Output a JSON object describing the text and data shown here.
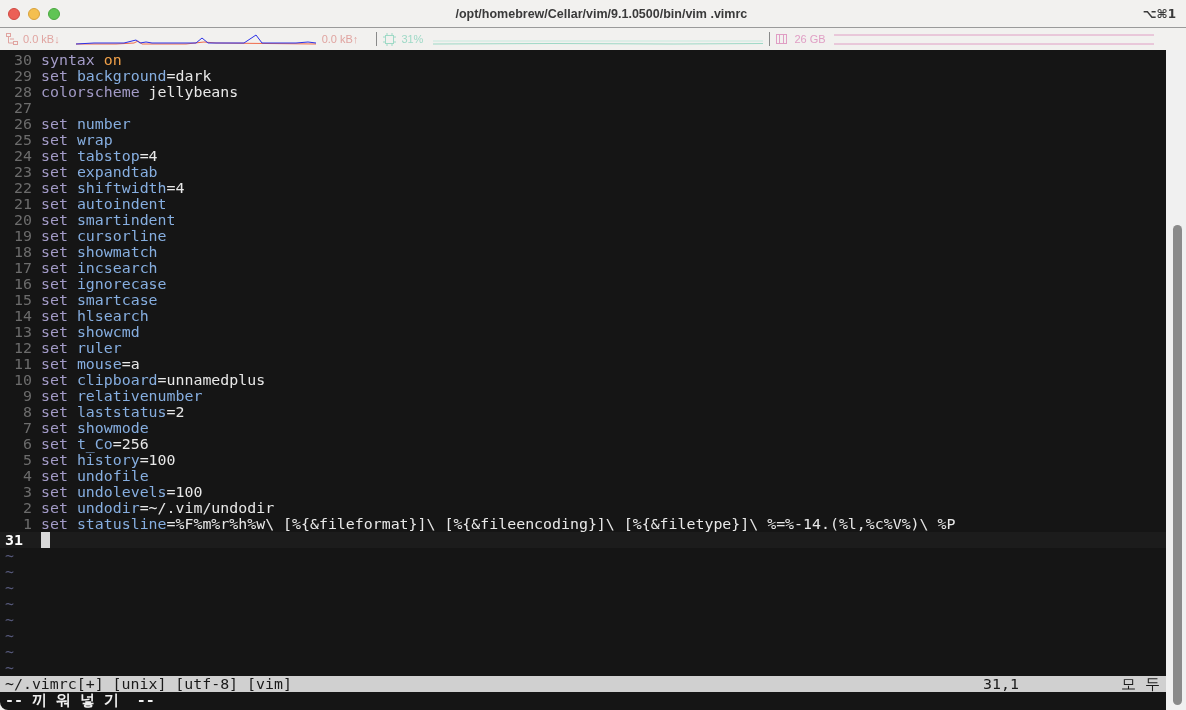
{
  "window": {
    "title": "/opt/homebrew/Cellar/vim/9.1.0500/bin/vim .vimrc",
    "shortcut": "⌥⌘1"
  },
  "stats_bar": {
    "network": {
      "down": "0.0 kB↓",
      "up": "0.0 kB↑"
    },
    "cpu": {
      "reading": "31%"
    },
    "memory": {
      "reading": "26 GB"
    }
  },
  "editor": {
    "lines": [
      {
        "n": "30",
        "cmd": "syntax",
        "arg": "on",
        "kind": "constant"
      },
      {
        "n": "29",
        "cmd": "set",
        "arg": "background",
        "val": "=dark",
        "kind": "option"
      },
      {
        "n": "28",
        "cmd": "colorscheme",
        "arg": "jellybeans",
        "kind": "plain"
      },
      {
        "n": "27"
      },
      {
        "n": "26",
        "cmd": "set",
        "arg": "number",
        "kind": "option"
      },
      {
        "n": "25",
        "cmd": "set",
        "arg": "wrap",
        "kind": "option"
      },
      {
        "n": "24",
        "cmd": "set",
        "arg": "tabstop",
        "val": "=4",
        "kind": "option"
      },
      {
        "n": "23",
        "cmd": "set",
        "arg": "expandtab",
        "kind": "option"
      },
      {
        "n": "22",
        "cmd": "set",
        "arg": "shiftwidth",
        "val": "=4",
        "kind": "option"
      },
      {
        "n": "21",
        "cmd": "set",
        "arg": "autoindent",
        "kind": "option"
      },
      {
        "n": "20",
        "cmd": "set",
        "arg": "smartindent",
        "kind": "option"
      },
      {
        "n": "19",
        "cmd": "set",
        "arg": "cursorline",
        "kind": "option"
      },
      {
        "n": "18",
        "cmd": "set",
        "arg": "showmatch",
        "kind": "option"
      },
      {
        "n": "17",
        "cmd": "set",
        "arg": "incsearch",
        "kind": "option"
      },
      {
        "n": "16",
        "cmd": "set",
        "arg": "ignorecase",
        "kind": "option"
      },
      {
        "n": "15",
        "cmd": "set",
        "arg": "smartcase",
        "kind": "option"
      },
      {
        "n": "14",
        "cmd": "set",
        "arg": "hlsearch",
        "kind": "option"
      },
      {
        "n": "13",
        "cmd": "set",
        "arg": "showcmd",
        "kind": "option"
      },
      {
        "n": "12",
        "cmd": "set",
        "arg": "ruler",
        "kind": "option"
      },
      {
        "n": "11",
        "cmd": "set",
        "arg": "mouse",
        "val": "=a",
        "kind": "option"
      },
      {
        "n": "10",
        "cmd": "set",
        "arg": "clipboard",
        "val": "=unnamedplus",
        "kind": "option"
      },
      {
        "n": "9",
        "cmd": "set",
        "arg": "relativenumber",
        "kind": "option"
      },
      {
        "n": "8",
        "cmd": "set",
        "arg": "laststatus",
        "val": "=2",
        "kind": "option"
      },
      {
        "n": "7",
        "cmd": "set",
        "arg": "showmode",
        "kind": "option"
      },
      {
        "n": "6",
        "cmd": "set",
        "arg": "t_Co",
        "val": "=256",
        "kind": "option"
      },
      {
        "n": "5",
        "cmd": "set",
        "arg": "history",
        "val": "=100",
        "kind": "option"
      },
      {
        "n": "4",
        "cmd": "set",
        "arg": "undofile",
        "kind": "option"
      },
      {
        "n": "3",
        "cmd": "set",
        "arg": "undolevels",
        "val": "=100",
        "kind": "option"
      },
      {
        "n": "2",
        "cmd": "set",
        "arg": "undodir",
        "val": "=~/.vim/undodir",
        "kind": "option"
      },
      {
        "n": "1",
        "cmd": "set",
        "arg": "statusline",
        "val": "=%F%m%r%h%w\\ [%{&fileformat}]\\ [%{&fileencoding}]\\ [%{&filetype}]\\ %=%-14.(%l,%c%V%)\\ %P",
        "kind": "option"
      }
    ],
    "cursor_line": {
      "n": "31"
    },
    "empty_lines": [
      "~",
      "~",
      "~",
      "~",
      "~",
      "~",
      "~",
      "~"
    ]
  },
  "status_line": {
    "file": "~/.vimrc[+] [unix] [utf-8] [vim]",
    "ruler": "31,1",
    "position": "모 두"
  },
  "mode_line": "-- 끼 워 넣 기  --"
}
